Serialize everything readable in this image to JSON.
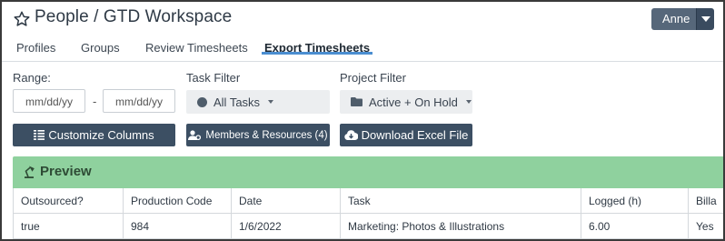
{
  "header": {
    "title": "People / GTD Workspace",
    "user_name": "Anne"
  },
  "tabs": [
    {
      "label": "Profiles"
    },
    {
      "label": "Groups"
    },
    {
      "label": "Review Timesheets"
    },
    {
      "label": "Export Timesheets",
      "active": true
    }
  ],
  "filters": {
    "range_label": "Range:",
    "date_from_placeholder": "mm/dd/yy",
    "date_separator": "-",
    "date_to_placeholder": "mm/dd/yy",
    "task_filter_label": "Task Filter",
    "task_filter_value": "All Tasks",
    "project_filter_label": "Project Filter",
    "project_filter_value": "Active + On Hold"
  },
  "buttons": {
    "customize_columns": "Customize Columns",
    "members_resources": "Members & Resources (4)",
    "download_excel": "Download Excel File"
  },
  "preview": {
    "title": "Preview",
    "columns": [
      "Outsourced?",
      "Production Code",
      "Date",
      "Task",
      "Logged (h)",
      "Billa"
    ],
    "rows": [
      [
        "true",
        "984",
        "1/6/2022",
        "Marketing: Photos & Illustrations",
        "6.00",
        "Yes"
      ]
    ]
  },
  "colors": {
    "accent": "#4b8ed1",
    "button": "#3c4f63",
    "preview_bar": "#8fd19e"
  }
}
